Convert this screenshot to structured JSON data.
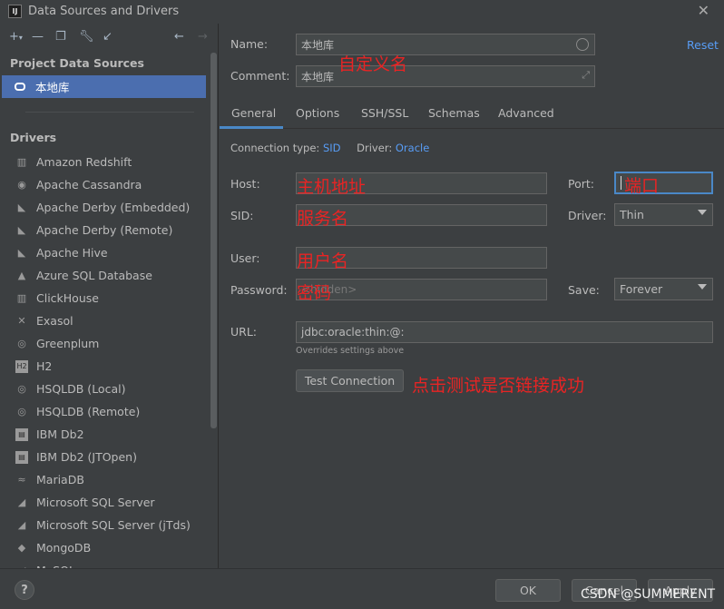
{
  "window": {
    "title": "Data Sources and Drivers"
  },
  "left": {
    "project_header": "Project Data Sources",
    "selected_source": "本地库",
    "drivers_header": "Drivers",
    "drivers": [
      {
        "label": "Amazon Redshift",
        "icon": "redshift-icon"
      },
      {
        "label": "Apache Cassandra",
        "icon": "cassandra-icon"
      },
      {
        "label": "Apache Derby (Embedded)",
        "icon": "derby-icon"
      },
      {
        "label": "Apache Derby (Remote)",
        "icon": "derby-icon"
      },
      {
        "label": "Apache Hive",
        "icon": "hive-icon"
      },
      {
        "label": "Azure SQL Database",
        "icon": "azure-icon"
      },
      {
        "label": "ClickHouse",
        "icon": "clickhouse-icon"
      },
      {
        "label": "Exasol",
        "icon": "exasol-icon"
      },
      {
        "label": "Greenplum",
        "icon": "greenplum-icon"
      },
      {
        "label": "H2",
        "icon": "h2-icon"
      },
      {
        "label": "HSQLDB (Local)",
        "icon": "hsqldb-icon"
      },
      {
        "label": "HSQLDB (Remote)",
        "icon": "hsqldb-icon"
      },
      {
        "label": "IBM Db2",
        "icon": "ibm-db2-icon"
      },
      {
        "label": "IBM Db2 (JTOpen)",
        "icon": "ibm-db2-icon"
      },
      {
        "label": "MariaDB",
        "icon": "mariadb-icon"
      },
      {
        "label": "Microsoft SQL Server",
        "icon": "mssql-icon"
      },
      {
        "label": "Microsoft SQL Server (jTds)",
        "icon": "mssql-icon"
      },
      {
        "label": "MongoDB",
        "icon": "mongodb-icon"
      },
      {
        "label": "MySQL",
        "icon": "mysql-icon"
      }
    ]
  },
  "form": {
    "name_label": "Name:",
    "name_value": "本地库",
    "reset": "Reset",
    "comment_label": "Comment:",
    "comment_value": "本地库",
    "tabs": [
      "General",
      "Options",
      "SSH/SSL",
      "Schemas",
      "Advanced"
    ],
    "connection_type_label": "Connection type:",
    "connection_type_value": "SID",
    "driver_label": "Driver:",
    "driver_value": "Oracle",
    "host_label": "Host:",
    "port_label": "Port:",
    "sid_label": "SID:",
    "driver_select_label": "Driver:",
    "driver_select_value": "Thin",
    "user_label": "User:",
    "password_label": "Password:",
    "password_placeholder": "<hidden>",
    "save_label": "Save:",
    "save_value": "Forever",
    "url_label": "URL:",
    "url_value": "jdbc:oracle:thin:@:",
    "url_hint": "Overrides settings above",
    "test_connection": "Test Connection"
  },
  "annotations": {
    "name": "自定义名",
    "host": "主机地址",
    "port": "端口",
    "sid": "服务名",
    "user": "用户名",
    "password": "密码",
    "test": "点击测试是否链接成功"
  },
  "footer": {
    "help": "?",
    "ok": "OK",
    "cancel": "Cancel",
    "apply": "Apply",
    "watermark": "CSDN @SUMMERENT"
  }
}
